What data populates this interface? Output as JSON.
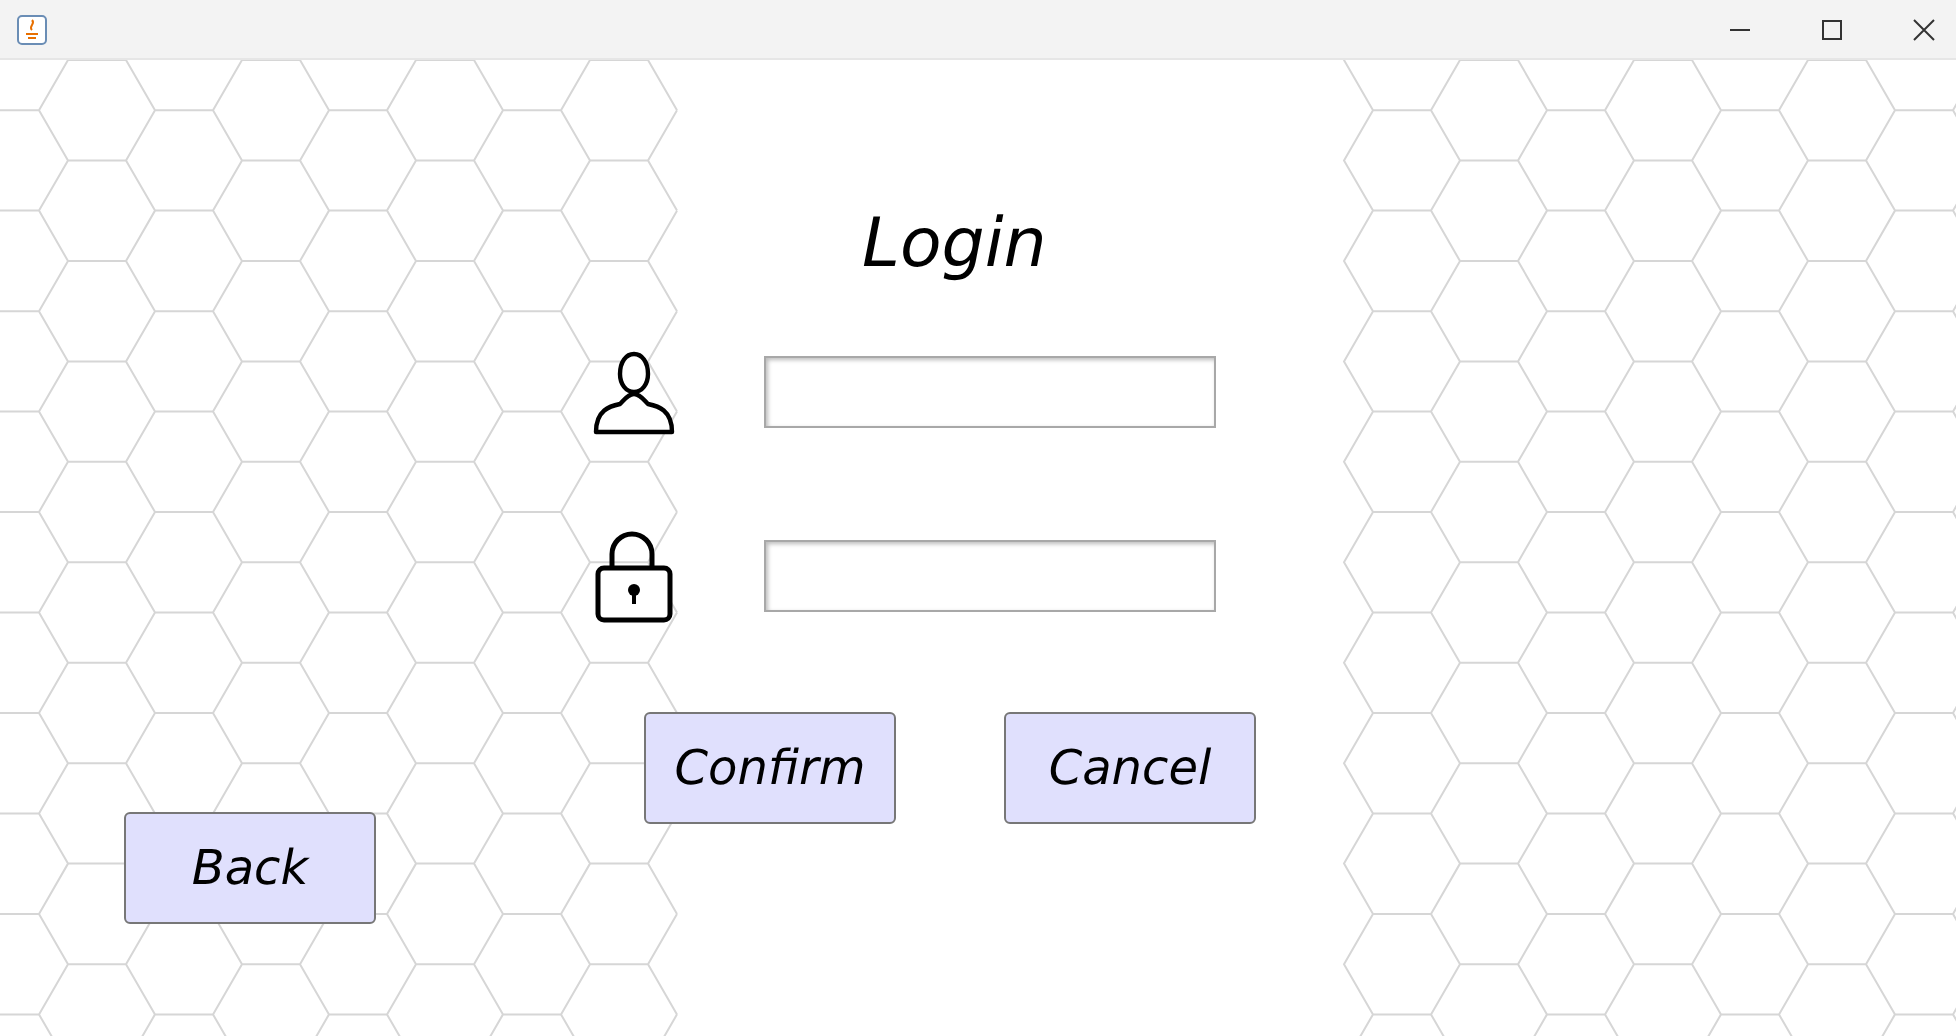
{
  "heading": "Login",
  "fields": [
    {
      "kind": "user"
    },
    {
      "kind": "password"
    }
  ],
  "actions": [
    {
      "label": "Confirm"
    },
    {
      "label": "Cancel"
    }
  ],
  "back_button": {
    "label": "Back"
  }
}
